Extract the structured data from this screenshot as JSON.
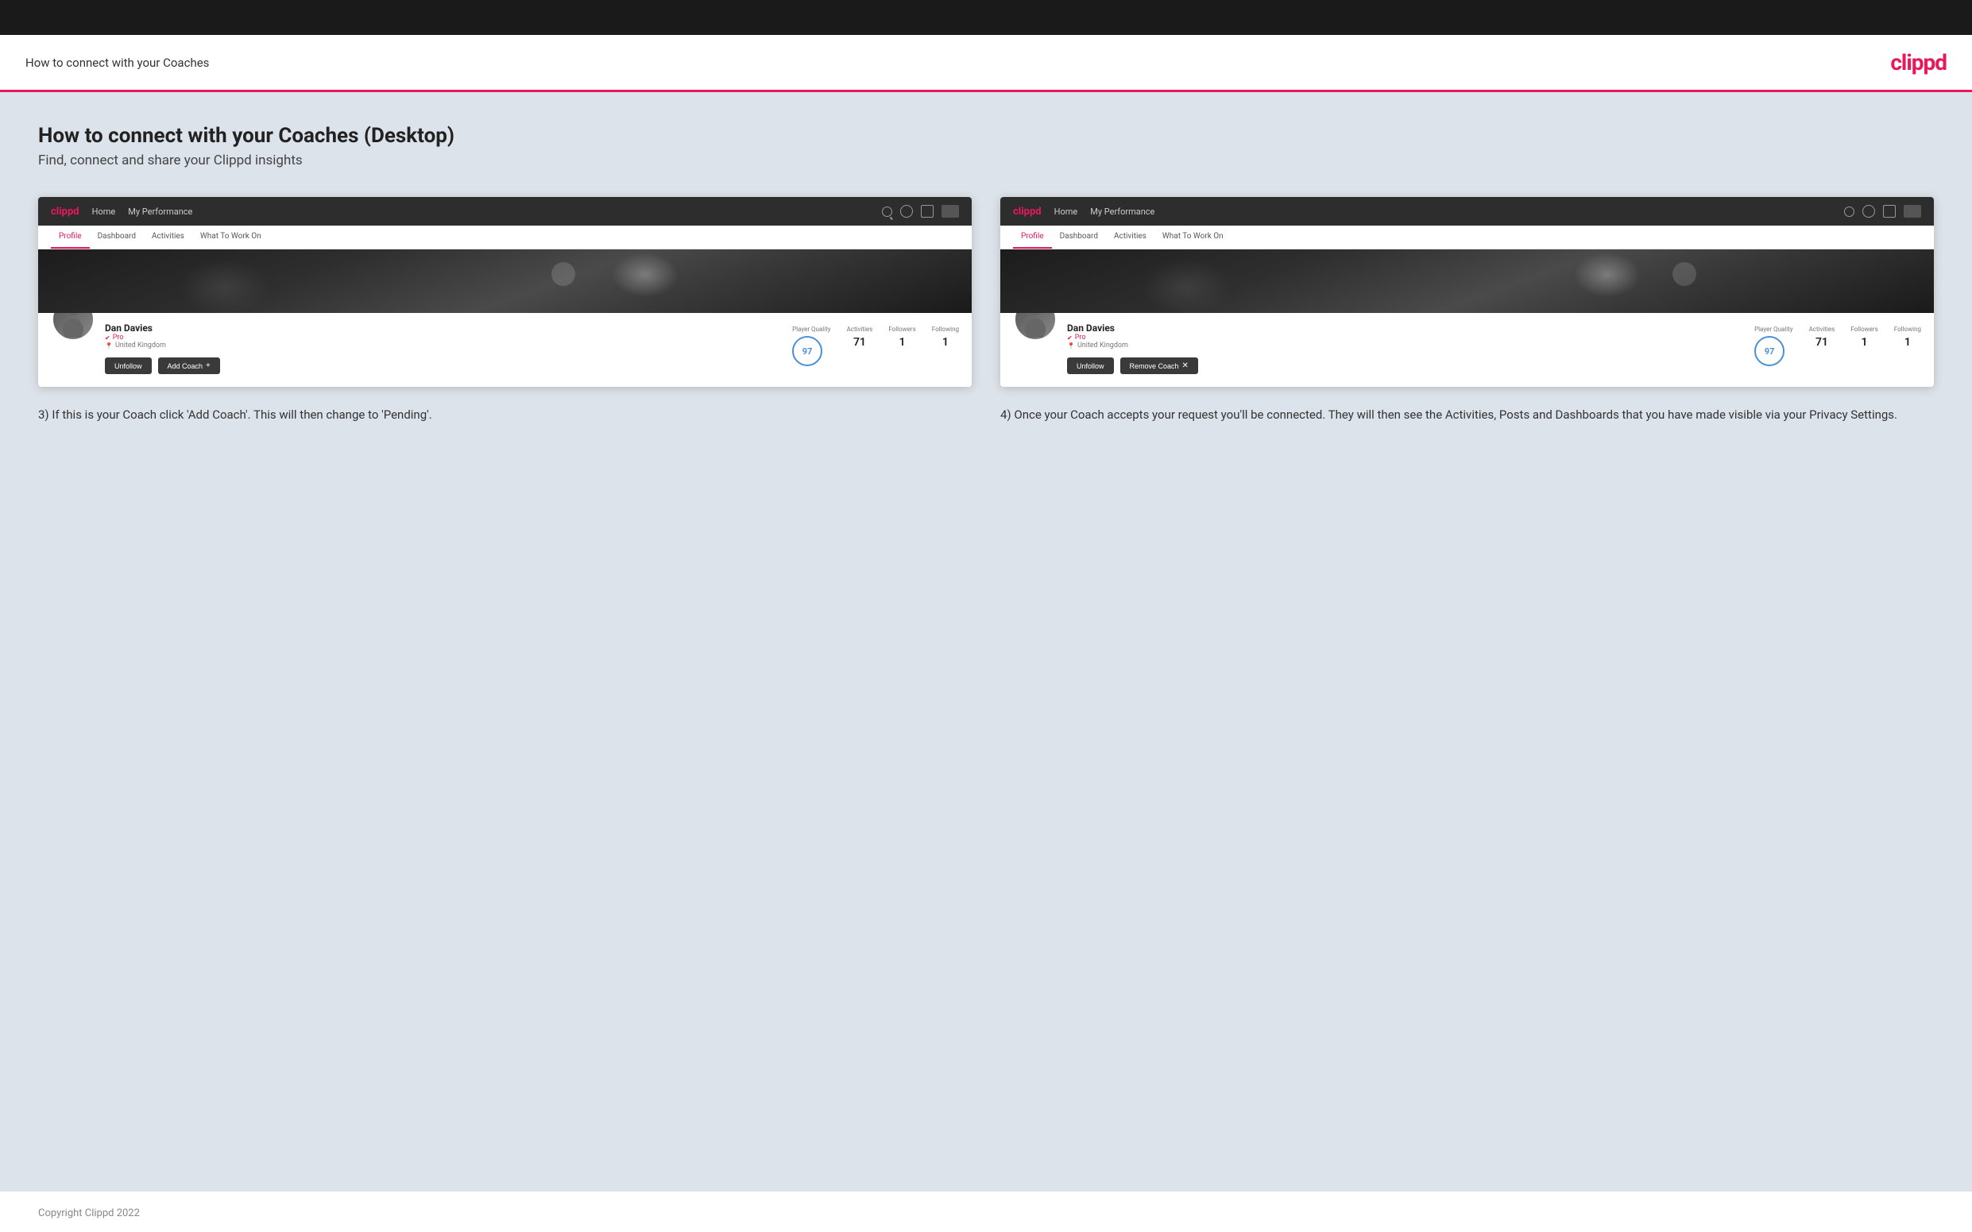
{
  "header": {
    "title": "How to connect with your Coaches",
    "logo": "clippd"
  },
  "page": {
    "heading": "How to connect with your Coaches (Desktop)",
    "subheading": "Find, connect and share your Clippd insights"
  },
  "screenshots": [
    {
      "id": "step3",
      "nav": {
        "logo": "clippd",
        "links": [
          "Home",
          "My Performance"
        ]
      },
      "tabs": [
        "Profile",
        "Dashboard",
        "Activities",
        "What To Work On"
      ],
      "active_tab": "Profile",
      "user": {
        "name": "Dan Davies",
        "badge": "Pro",
        "location": "United Kingdom",
        "player_quality": "97",
        "activities": "71",
        "followers": "1",
        "following": "1"
      },
      "buttons": [
        "Unfollow",
        "Add Coach"
      ],
      "description": "3) If this is your Coach click 'Add Coach'. This will then change to 'Pending'."
    },
    {
      "id": "step4",
      "nav": {
        "logo": "clippd",
        "links": [
          "Home",
          "My Performance"
        ]
      },
      "tabs": [
        "Profile",
        "Dashboard",
        "Activities",
        "What To Work On"
      ],
      "active_tab": "Profile",
      "user": {
        "name": "Dan Davies",
        "badge": "Pro",
        "location": "United Kingdom",
        "player_quality": "97",
        "activities": "71",
        "followers": "1",
        "following": "1"
      },
      "buttons": [
        "Unfollow",
        "Remove Coach"
      ],
      "description": "4) Once your Coach accepts your request you'll be connected. They will then see the Activities, Posts and Dashboards that you have made visible via your Privacy Settings."
    }
  ],
  "footer": {
    "copyright": "Copyright Clippd 2022"
  }
}
